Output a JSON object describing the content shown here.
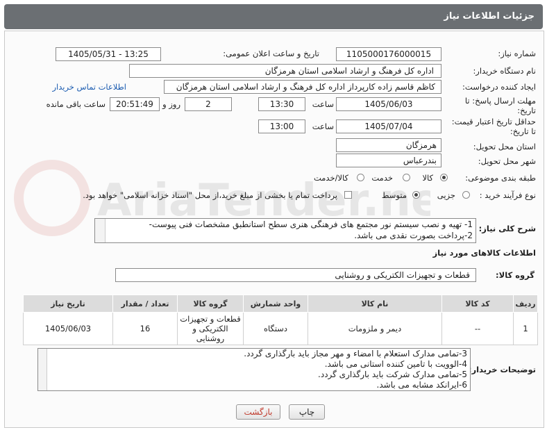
{
  "header": {
    "title": "جزئیات اطلاعات نیاز"
  },
  "fields": {
    "need_number_label": "شماره نیاز:",
    "need_number": "1105000176000015",
    "announce_label": "تاریخ و ساعت اعلان عمومی:",
    "announce_value": "1405/05/31 - 13:25",
    "buyer_label": "نام دستگاه خریدار:",
    "buyer_value": "اداره کل فرهنگ و ارشاد اسلامی استان هرمزگان",
    "creator_label": "ایجاد کننده درخواست:",
    "creator_value": "کاظم قاسم زاده کارپرداز اداره کل فرهنگ و ارشاد اسلامی استان هرمزگان",
    "contact_link": "اطلاعات تماس خریدار",
    "deadline_label_1": "مهلت ارسال پاسخ: تا",
    "deadline_label_2": "تاریخ:",
    "deadline_date": "1405/06/03",
    "time_label": "ساعت",
    "deadline_time": "13:30",
    "days_value": "2",
    "days_label": "روز و",
    "remaining_time": "20:51:49",
    "remaining_label": "ساعت باقی مانده",
    "validity_label_1": "حداقل تاریخ اعتبار قیمت:",
    "validity_label_2": "تا تاریخ:",
    "validity_date": "1405/07/04",
    "validity_time_label": "ساعت",
    "validity_time": "13:00",
    "province_label": "استان محل تحویل:",
    "province_value": "هرمزگان",
    "city_label": "شهر محل تحویل:",
    "city_value": "بندرعباس",
    "category_label": "طبقه بندی موضوعی:",
    "category_options": [
      "کالا",
      "خدمت",
      "کالا/خدمت"
    ],
    "category_selected": "کالا",
    "process_label": "نوع فرآیند خرید :",
    "process_options": [
      "جزیی",
      "متوسط"
    ],
    "process_selected": "متوسط",
    "payment_note": "پرداخت تمام یا بخشی از مبلغ خرید،از محل \"اسناد خزانه اسلامی\" خواهد بود.",
    "summary_label": "شرح کلی نیاز:",
    "summary_lines": [
      "1- تهیه و نصب سیستم نور مجتمع های فرهنگی هنری سطح استانطبق مشخصات فنی پیوست-",
      "2-پرداخت بصورت نقدی می باشد."
    ]
  },
  "goods": {
    "section_title": "اطلاعات کالاهای مورد نیاز",
    "group_label": "گروه کالا:",
    "group_value": "قطعات و تجهیزات الکتریکی و روشنایی",
    "columns": [
      "ردیف",
      "کد کالا",
      "نام کالا",
      "واحد شمارش",
      "گروه کالا",
      "تعداد / مقدار",
      "تاریخ نیاز"
    ],
    "rows": [
      [
        "1",
        "--",
        "دیمر و ملزومات",
        "دستگاه",
        "قطعات و تجهیزات الکتریکی و روشنایی",
        "16",
        "1405/06/03"
      ]
    ]
  },
  "buyer_notes": {
    "label": "توضیحات خریدار:",
    "lines": [
      "3-تمامی مدارک استعلام با امضاء و مهر مجاز باید بارگذاری گردد.",
      "4-الوویت با تامین کننده استانی می باشد.",
      "5-تمامی مدارک شرکت باید بارگذاری گردد.",
      "6-ایرانکد مشابه می باشد."
    ]
  },
  "buttons": {
    "print": "چاپ",
    "back": "بازگشت"
  },
  "watermark_text": "AriaTender.net",
  "colors": {
    "header": "#6b6f73",
    "link": "#1a5bb0",
    "back_text": "#c0392b"
  }
}
